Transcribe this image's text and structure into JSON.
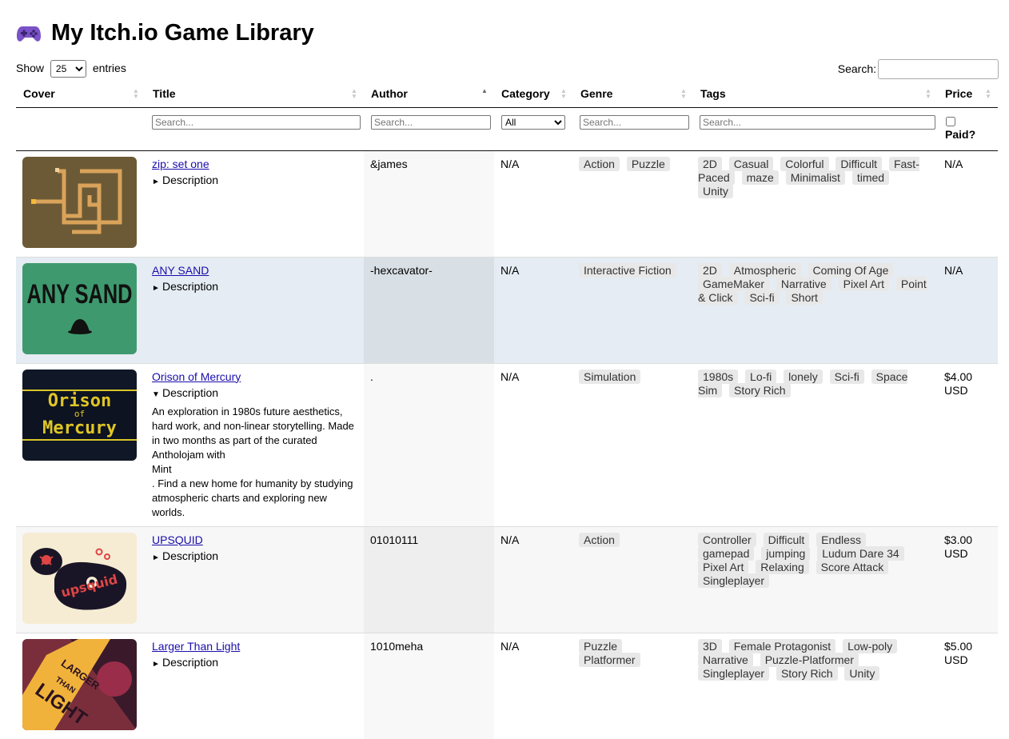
{
  "page": {
    "title": "My Itch.io Game Library",
    "icon": "game-controller-icon"
  },
  "controls": {
    "show_label": "Show",
    "page_size": "25",
    "entries_label": "entries",
    "search_label": "Search:",
    "search_value": ""
  },
  "columns": [
    "Cover",
    "Title",
    "Author",
    "Category",
    "Genre",
    "Tags",
    "Price"
  ],
  "filters": {
    "placeholder": "Search...",
    "category_selected": "All",
    "paid_label": "Paid?"
  },
  "games": [
    {
      "title": "zip: set one",
      "author": "&james",
      "category": "N/A",
      "genres": [
        "Action",
        "Puzzle"
      ],
      "tags": [
        "2D",
        "Casual",
        "Colorful",
        "Difficult",
        "Fast-Paced",
        "maze",
        "Minimalist",
        "timed",
        "Unity"
      ],
      "price": "N/A",
      "description_label": "Description",
      "description_open": false,
      "cover": "maze-cover"
    },
    {
      "title": "ANY SAND",
      "author": "-hexcavator-",
      "category": "N/A",
      "genres": [
        "Interactive Fiction"
      ],
      "tags": [
        "2D",
        "Atmospheric",
        "Coming Of Age",
        "GameMaker",
        "Narrative",
        "Pixel Art",
        "Point & Click",
        "Sci-fi",
        "Short"
      ],
      "price": "N/A",
      "description_label": "Description",
      "description_open": false,
      "cover": "any-sand-cover",
      "cover_text": "ANY SAND"
    },
    {
      "title": "Orison of Mercury",
      "author": ".",
      "category": "N/A",
      "genres": [
        "Simulation"
      ],
      "tags": [
        "1980s",
        "Lo-fi",
        "lonely",
        "Sci-fi",
        "Space Sim",
        "Story Rich"
      ],
      "price": "$4.00 USD",
      "description_label": "Description",
      "description_open": true,
      "description_lines": [
        "An exploration in 1980s future aesthetics, hard work, and non-linear storytelling. Made in two months as part of the curated Antholojam with",
        "Mint",
        ". Find a new home for humanity by studying atmospheric charts and exploring new worlds."
      ],
      "cover": "orison-cover",
      "cover_text": [
        "Orison",
        "of",
        "Mercury"
      ]
    },
    {
      "title": "UPSQUID",
      "author": "01010111",
      "category": "N/A",
      "genres": [
        "Action"
      ],
      "tags": [
        "Controller",
        "Difficult",
        "Endless",
        "gamepad",
        "jumping",
        "Ludum Dare 34",
        "Pixel Art",
        "Relaxing",
        "Score Attack",
        "Singleplayer"
      ],
      "price": "$3.00 USD",
      "description_label": "Description",
      "description_open": false,
      "cover": "upsquid-cover",
      "cover_text": "upsquid"
    },
    {
      "title": "Larger Than Light",
      "author": "1010meha",
      "category": "N/A",
      "genres": [
        "Puzzle",
        "Platformer"
      ],
      "tags": [
        "3D",
        "Female Protagonist",
        "Low-poly",
        "Narrative",
        "Puzzle-Platformer",
        "Singleplayer",
        "Story Rich",
        "Unity"
      ],
      "price": "$5.00 USD",
      "description_label": "Description",
      "description_open": false,
      "cover": "larger-than-light-cover",
      "cover_text": [
        "LARGER",
        "THAN",
        "LIGHT"
      ]
    }
  ]
}
